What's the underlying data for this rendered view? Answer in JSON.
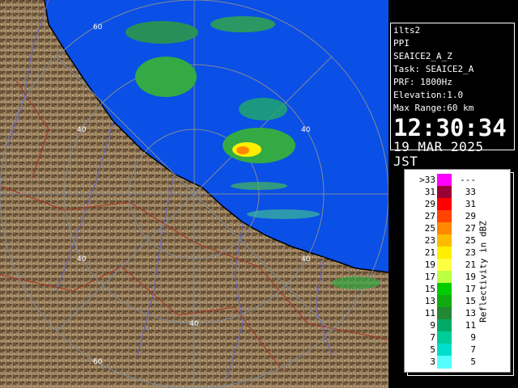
{
  "info": {
    "station": "ilts2",
    "product": "PPI",
    "task": "SEAICE2_A_Z",
    "task_line": "Task: SEAICE2_A",
    "prf": "PRF: 1800Hz",
    "elevation": "Elevation:1.0",
    "max_range": "Max Range:60 km",
    "time": "12:30:34",
    "date": "19 MAR 2025 JST"
  },
  "range_labels": [
    "60",
    "40",
    "40",
    "40",
    "40",
    "60",
    "40"
  ],
  "legend": {
    "title": "Reflectivity in dBZ",
    "rows": [
      {
        "left": ">33",
        "right": "---",
        "color": "#ff00ff"
      },
      {
        "left": "31",
        "right": "33",
        "color": "#990033"
      },
      {
        "left": "29",
        "right": "31",
        "color": "#ff0000"
      },
      {
        "left": "27",
        "right": "29",
        "color": "#ff4400"
      },
      {
        "left": "25",
        "right": "27",
        "color": "#ff8800"
      },
      {
        "left": "23",
        "right": "25",
        "color": "#ffbb00"
      },
      {
        "left": "21",
        "right": "23",
        "color": "#ffee00"
      },
      {
        "left": "19",
        "right": "21",
        "color": "#ffff44"
      },
      {
        "left": "17",
        "right": "19",
        "color": "#bbff44"
      },
      {
        "left": "15",
        "right": "17",
        "color": "#00cc00"
      },
      {
        "left": "13",
        "right": "15",
        "color": "#11aa11"
      },
      {
        "left": "11",
        "right": "13",
        "color": "#228833"
      },
      {
        "left": "9",
        "right": "11",
        "color": "#00aa66"
      },
      {
        "left": "7",
        "right": "9",
        "color": "#00cc99"
      },
      {
        "left": "5",
        "right": "7",
        "color": "#00ddcc"
      },
      {
        "left": "3",
        "right": "5",
        "color": "#55ffff"
      }
    ]
  },
  "colors": {
    "sea": "#0a4fe6",
    "land": "#8c7455",
    "coastline": "#000000",
    "range_rings": "#7f8a99",
    "rivers": "#6666cc",
    "boundaries": "#aa3322"
  }
}
